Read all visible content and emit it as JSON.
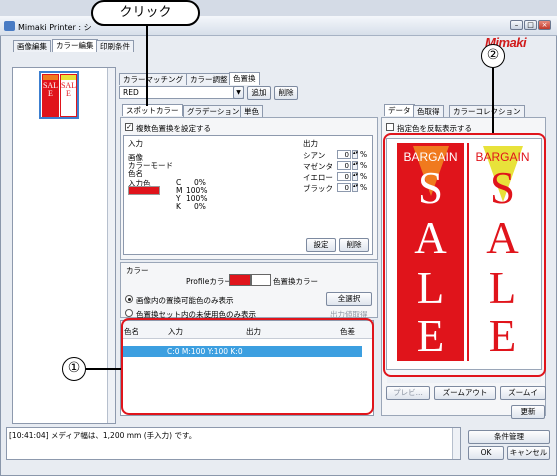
{
  "callout": {
    "label": "クリック",
    "marker1": "①",
    "marker2": "②"
  },
  "window": {
    "title": "Mimaki Printer : シ",
    "brand": "Mimaki"
  },
  "main_tabs": [
    "画像編集",
    "カラー編集",
    "印刷条件"
  ],
  "thumbnail": {
    "text_left": "SALE",
    "text_right": "SALE"
  },
  "sub_tabs": [
    "カラーマッチング",
    "カラー調整",
    "色置換"
  ],
  "color_set": {
    "value": "RED",
    "add_label": "追加",
    "delete_label": "削除"
  },
  "spot_tabs": [
    "スポットカラー",
    "グラデーション",
    "単色"
  ],
  "multi_replace": {
    "label": "複数色置換を設定する",
    "checked": true
  },
  "input": {
    "heading": "入力",
    "rows": [
      "画像",
      "カラーモード",
      "色名"
    ],
    "color_label": "入力色",
    "cmyk": [
      {
        "ch": "C",
        "val": "0%"
      },
      {
        "ch": "M",
        "val": "100%"
      },
      {
        "ch": "Y",
        "val": "100%"
      },
      {
        "ch": "K",
        "val": "0%"
      }
    ],
    "swatch_color": "#e0141b"
  },
  "output": {
    "heading": "出力",
    "channels": [
      {
        "name": "シアン",
        "value": "0",
        "unit": "%"
      },
      {
        "name": "マゼンタ",
        "value": "0",
        "unit": "%"
      },
      {
        "name": "イエロー",
        "value": "0",
        "unit": "%"
      },
      {
        "name": "ブラック",
        "value": "0",
        "unit": "%"
      }
    ],
    "set_label": "設定",
    "delete_label": "削除"
  },
  "color_section": {
    "heading": "カラー",
    "profile_label": "Profileカラー",
    "replace_label": "色置換カラー",
    "radio1": "画像内の置換可能色のみ表示",
    "radio2": "色置換セット内の未使用色のみ表示",
    "select_all_label": "全選択",
    "output_get_label": "出力値取得"
  },
  "table": {
    "headers": [
      "色名",
      "入力",
      "出力",
      "色差"
    ],
    "rows": [
      {
        "name": "",
        "input": "C:0 M:100 Y:100 K:0",
        "output": "",
        "diff": ""
      }
    ]
  },
  "preview_tabs": [
    "データ",
    "色取得",
    "カラーコレクション"
  ],
  "invert": {
    "label": "指定色を反転表示する",
    "checked": false
  },
  "preview": {
    "banner_left": "BARGAIN",
    "banner_right": "BARGAIN",
    "sale_letters": [
      "S",
      "A",
      "L",
      "E"
    ]
  },
  "preview_buttons": {
    "preview": "プレビ...",
    "zoom_out": "ズームアウト",
    "zoom_in": "ズームイ"
  },
  "refresh_label": "更新",
  "log": {
    "message": "[10:41:04] メディア幅は、1,200 mm (手入力) です。"
  },
  "footer": {
    "conditions_label": "条件管理",
    "ok_label": "OK",
    "cancel_label": "キャンセル"
  },
  "colors": {
    "accent_red": "#e0141b",
    "selection_blue": "#3c9fe0",
    "banner_yellow": "#e8e23a",
    "banner_orange": "#f07a1e"
  }
}
